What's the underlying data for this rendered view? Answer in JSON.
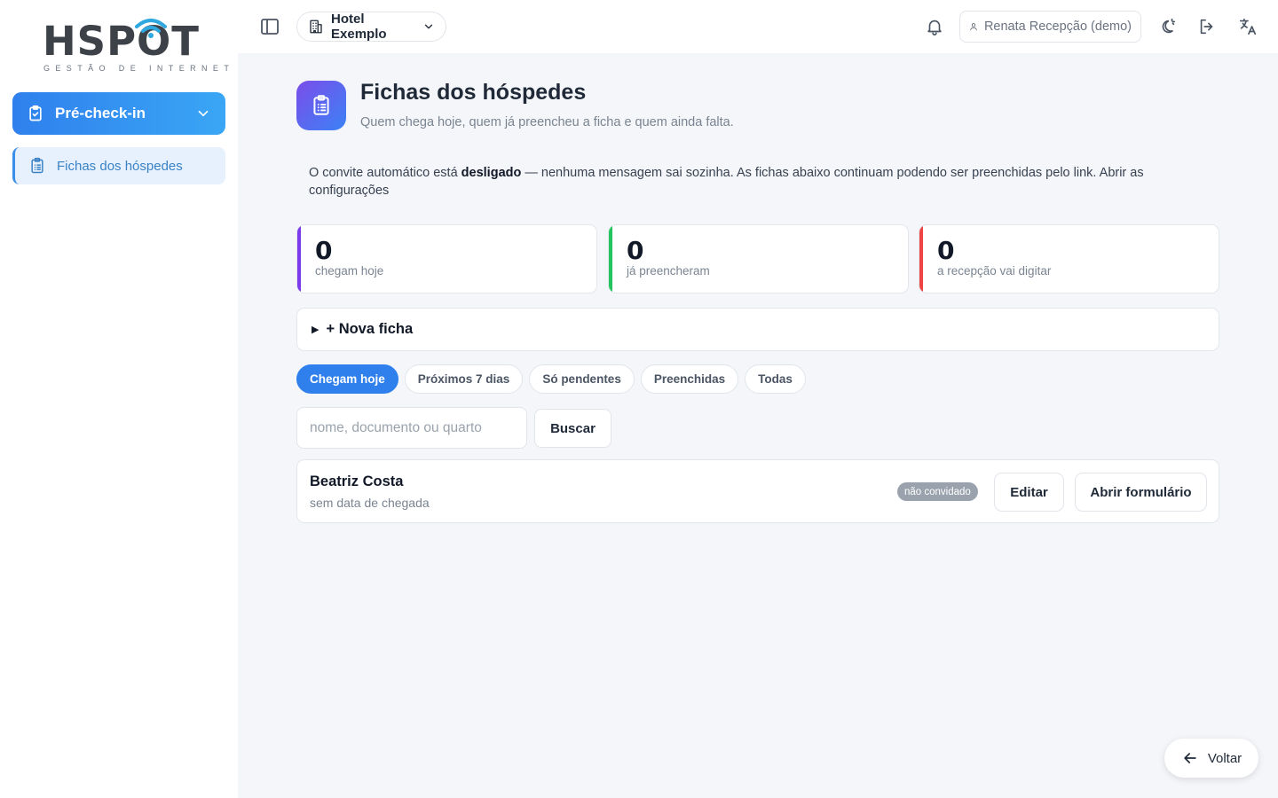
{
  "brand": {
    "name": "HSPOT",
    "tagline": "GESTÃO DE INTERNET",
    "accent": "#2f80ed"
  },
  "sidebar": {
    "group": {
      "label": "Pré-check-in",
      "icon": "clipboard-check-icon"
    },
    "items": [
      {
        "label": "Fichas dos hóspedes",
        "icon": "clipboard-list-icon",
        "active": true
      }
    ]
  },
  "topbar": {
    "hotel": "Hotel Exemplo",
    "user": "Renata Recepção (demo)"
  },
  "page": {
    "title": "Fichas dos hóspedes",
    "subtitle": "Quem chega hoje, quem já preencheu a ficha e quem ainda falta."
  },
  "notice": {
    "prefix": "O convite automático está ",
    "strong": "desligado",
    "suffix": " — nenhuma mensagem sai sozinha. As fichas abaixo continuam podendo ser preenchidas pelo link. Abrir as configurações"
  },
  "stats": [
    {
      "value": "0",
      "label": "chegam hoje",
      "color": "#7c3aed"
    },
    {
      "value": "0",
      "label": "já preencheram",
      "color": "#22c55e"
    },
    {
      "value": "0",
      "label": "a recepção vai digitar",
      "color": "#ef4444"
    }
  ],
  "new_form": {
    "label": "+ Nova ficha"
  },
  "filters": [
    "Chegam hoje",
    "Próximos 7 dias",
    "Só pendentes",
    "Preenchidas",
    "Todas"
  ],
  "search": {
    "placeholder": "nome, documento ou quarto",
    "value": "",
    "button": "Buscar"
  },
  "guests": [
    {
      "name": "Beatriz Costa",
      "arrival": "sem data de chegada",
      "status": "não convidado",
      "edit": "Editar",
      "open": "Abrir formulário"
    }
  ],
  "back": {
    "label": "Voltar"
  }
}
